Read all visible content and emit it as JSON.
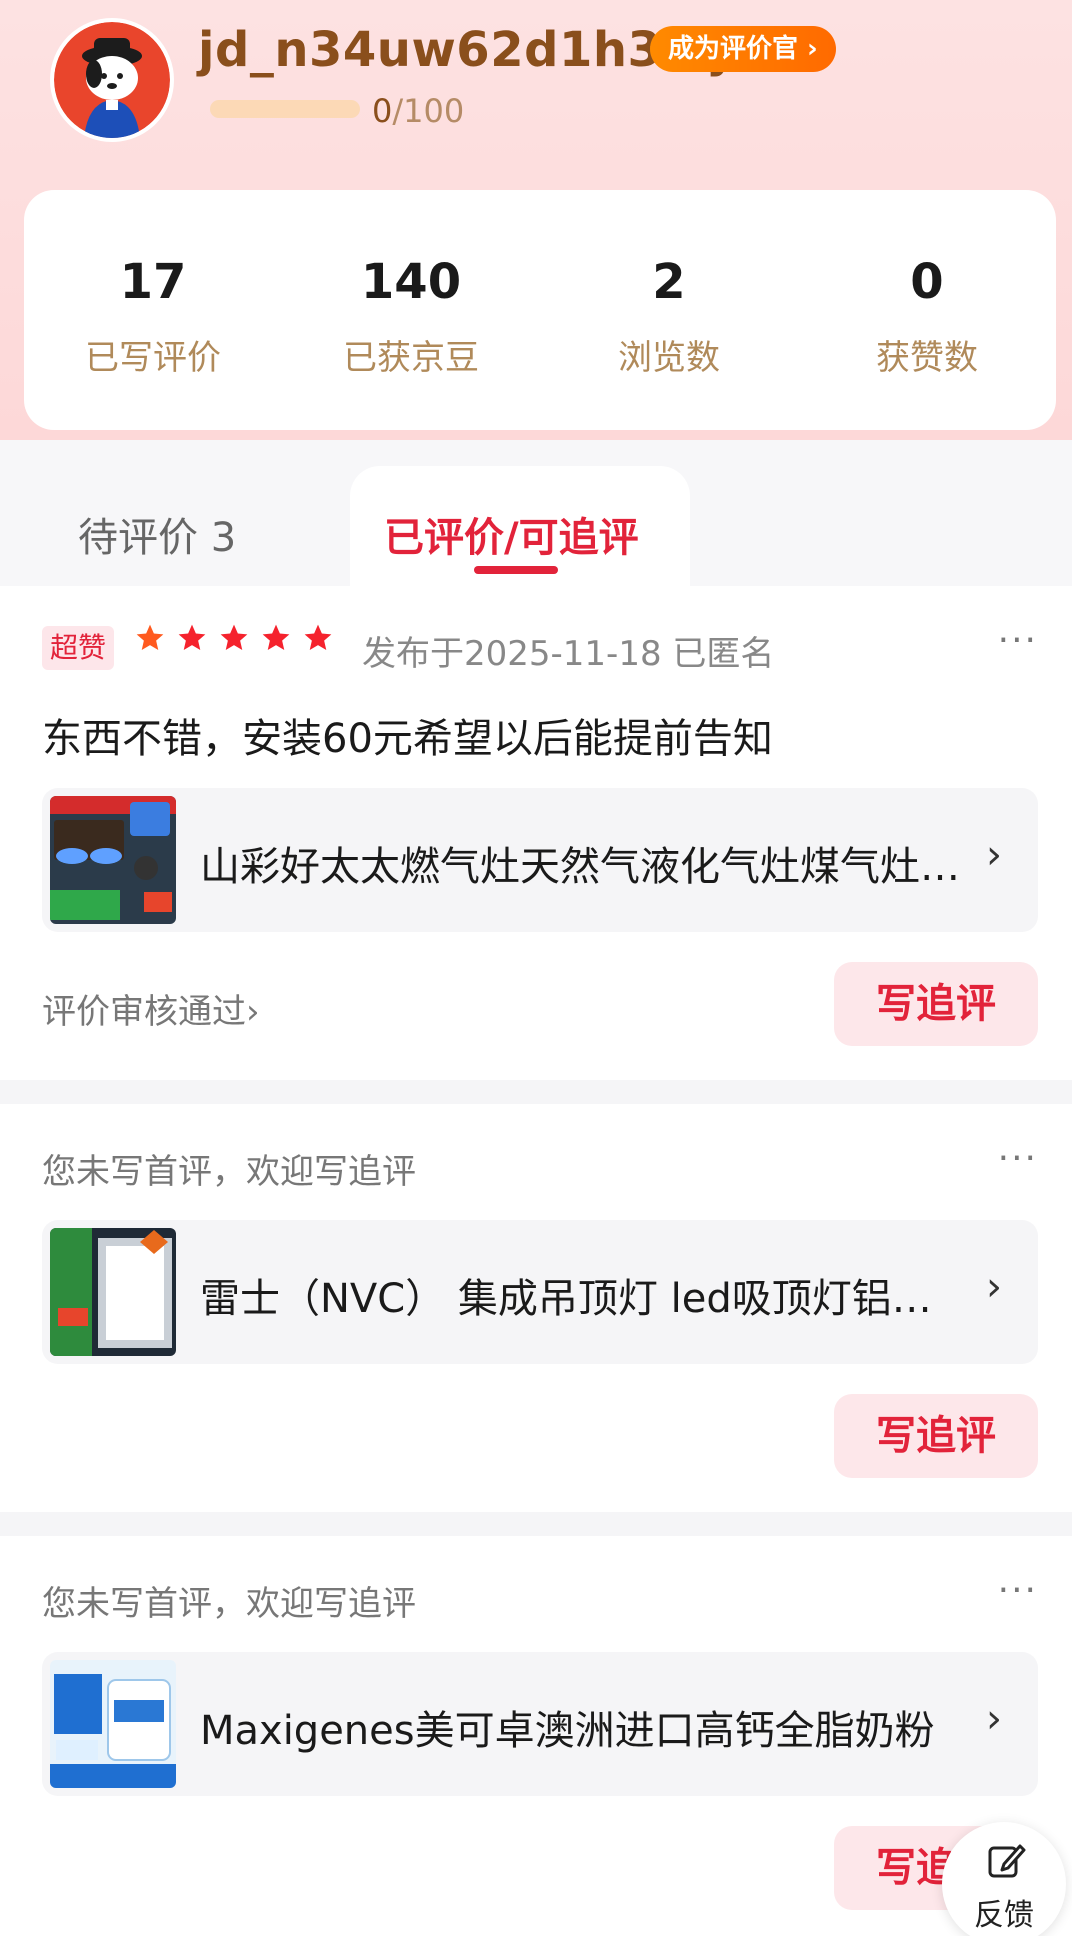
{
  "profile": {
    "username": "jd_n34uw62d1h3l7j",
    "badge_label": "成为评价官 ›",
    "progress_current": "0",
    "progress_total": "/100",
    "progress_fraction": 0
  },
  "stats": [
    {
      "value": "17",
      "label": "已写评价"
    },
    {
      "value": "140",
      "label": "已获京豆"
    },
    {
      "value": "2",
      "label": "浏览数"
    },
    {
      "value": "0",
      "label": "获赞数"
    }
  ],
  "tabs": {
    "pending": "待评价 3",
    "done": "已评价/可追评"
  },
  "reviews": [
    {
      "tag": "超赞",
      "rating": 5,
      "meta": "发布于2025-11-18  已匿名",
      "more": "···",
      "text": "东西不错，安装60元希望以后能提前告知",
      "product_title": "山彩好太太燃气灶天然气液化气灶煤气灶双灶家用台式嵌入式猛火灶",
      "chevron": "›",
      "status": "评价审核通过›",
      "button": "写追评"
    },
    {
      "prompt": "您未写首评，欢迎写追评",
      "more": "···",
      "product_title": "雷士（NVC） 集成吊顶灯 led吸顶灯铝扣板平板灯",
      "chevron": "›",
      "button": "写追评"
    },
    {
      "prompt": "您未写首评，欢迎写追评",
      "more": "···",
      "product_title": "Maxigenes美可卓澳洲进口高钙全脂奶粉",
      "chevron": "›",
      "button": "写追评"
    }
  ],
  "feedback": {
    "label": "反馈",
    "icon": "edit-icon"
  },
  "colors": {
    "accent": "#e2233a",
    "gold": "#b08a5a",
    "orange": "#ff7a00"
  }
}
